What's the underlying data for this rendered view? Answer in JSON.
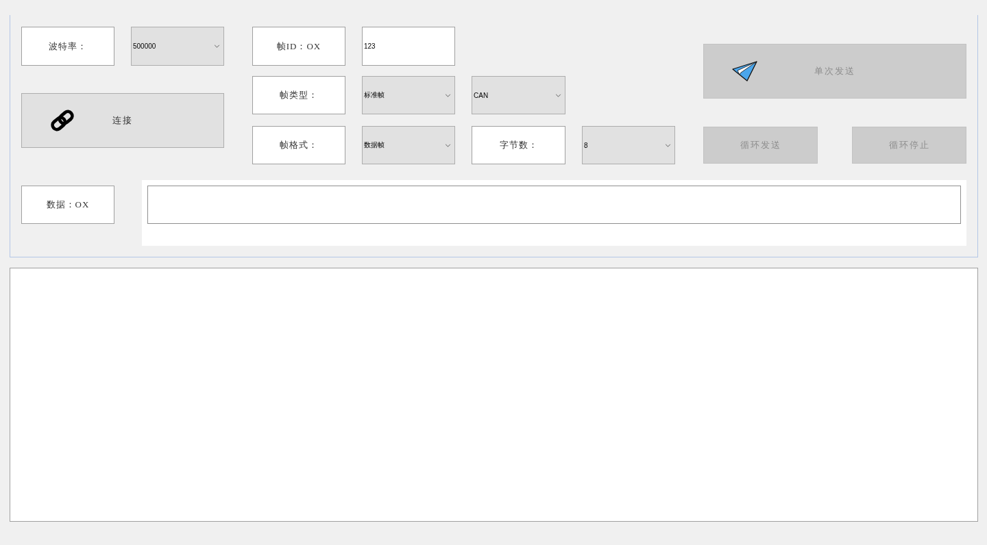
{
  "connection": {
    "baud_rate_label": "波特率：",
    "baud_rate": "500000",
    "connect_button": {
      "label": "连接",
      "disabled": false
    }
  },
  "frame": {
    "id_label": "帧ID：OX",
    "id": "123",
    "type_label": "帧类型：",
    "type": "标准帧",
    "protocol": "CAN",
    "format_label": "帧格式：",
    "format": "数据帧",
    "byte_count_label": "字节数：",
    "byte_count": "8"
  },
  "send_buttons": [
    {
      "kind": "single",
      "label": "单次发送",
      "disabled": true
    },
    {
      "kind": "loop",
      "label": "循环发送",
      "disabled": true
    },
    {
      "kind": "stop",
      "label": "循环停止",
      "disabled": true
    }
  ],
  "data": {
    "label": "数据：OX"
  }
}
